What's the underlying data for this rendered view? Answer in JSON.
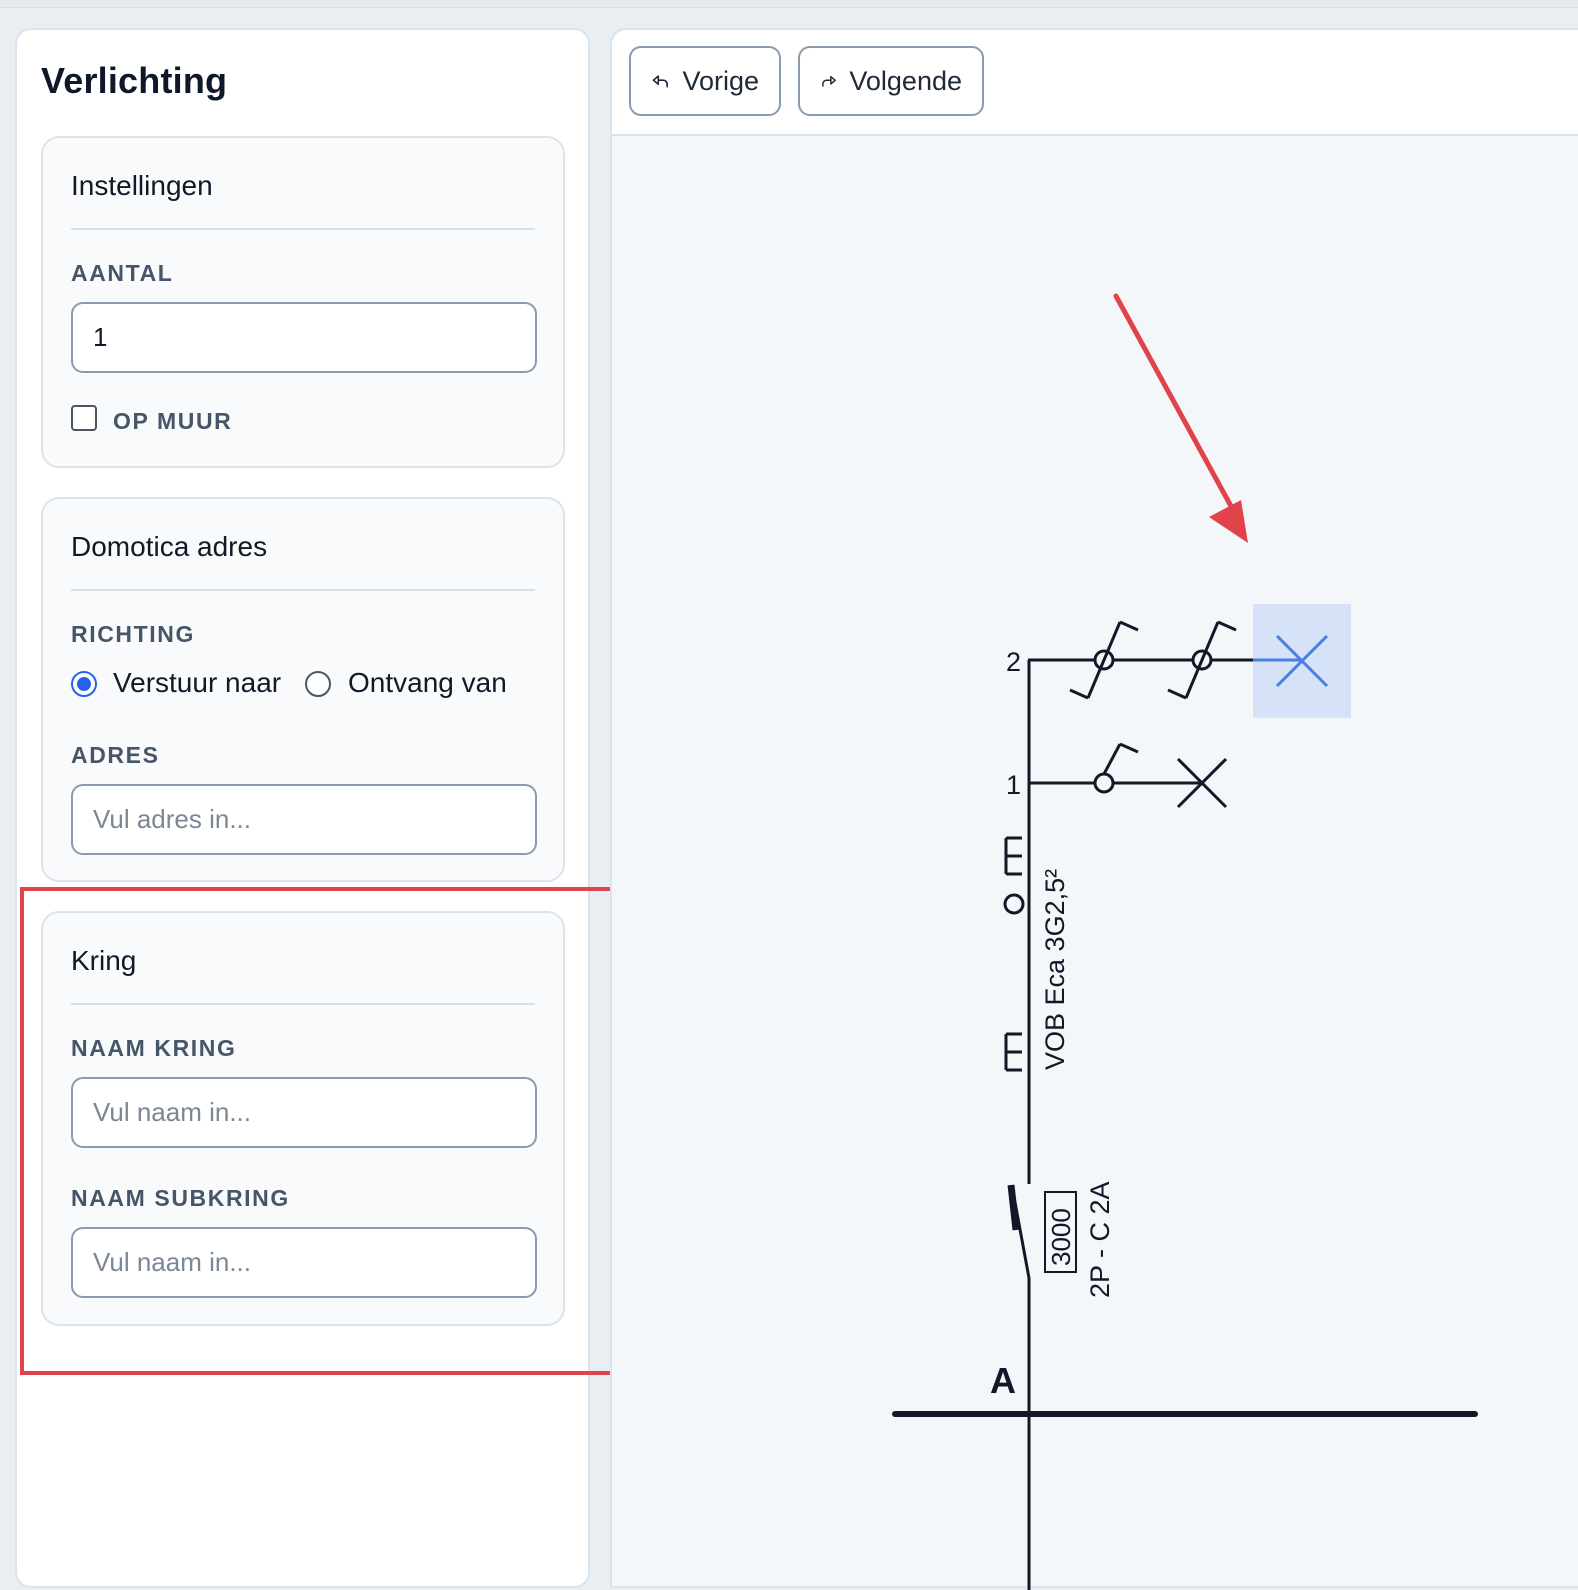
{
  "panel": {
    "title": "Verlichting"
  },
  "settings": {
    "title": "Instellingen",
    "aantal_label": "AANTAL",
    "aantal_value": "1",
    "op_muur_label": "OP MUUR",
    "op_muur_checked": false
  },
  "domotica": {
    "title": "Domotica adres",
    "richting_label": "RICHTING",
    "option_send": "Verstuur naar",
    "option_receive": "Ontvang van",
    "selected": "Verstuur naar",
    "adres_label": "ADRES",
    "adres_placeholder": "Vul adres in..."
  },
  "kring": {
    "title": "Kring",
    "naam_kring_label": "NAAM KRING",
    "naam_kring_placeholder": "Vul naam in...",
    "naam_subkring_label": "NAAM SUBKRING",
    "naam_subkring_placeholder": "Vul naam in..."
  },
  "toolbar": {
    "prev_label": "Vorige",
    "next_label": "Volgende"
  },
  "diagram": {
    "bus_label": "A",
    "breaker_rating": "3000",
    "breaker_spec": "2P - C 2A",
    "cable_spec": "VOB Eca 3G2,5²",
    "circuit_1": "1",
    "circuit_2": "2",
    "highlight_color": "#d6e2f7",
    "selected_color": "#4a7ee0",
    "arrow_color": "#e0434a"
  }
}
